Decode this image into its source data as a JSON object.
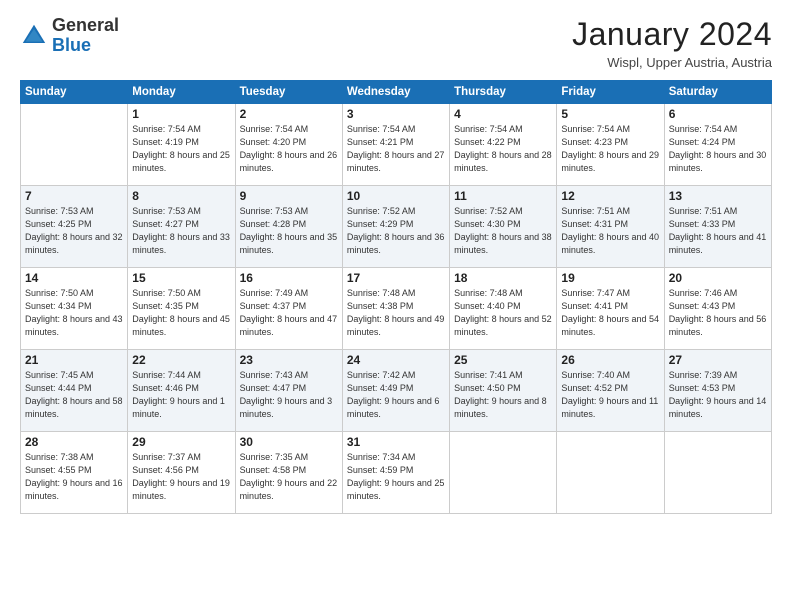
{
  "logo": {
    "text_general": "General",
    "text_blue": "Blue"
  },
  "header": {
    "month_title": "January 2024",
    "location": "Wispl, Upper Austria, Austria"
  },
  "days_of_week": [
    "Sunday",
    "Monday",
    "Tuesday",
    "Wednesday",
    "Thursday",
    "Friday",
    "Saturday"
  ],
  "weeks": [
    {
      "days": [
        {
          "num": "",
          "sunrise": "",
          "sunset": "",
          "daylight": "",
          "empty": true
        },
        {
          "num": "1",
          "sunrise": "Sunrise: 7:54 AM",
          "sunset": "Sunset: 4:19 PM",
          "daylight": "Daylight: 8 hours and 25 minutes.",
          "empty": false
        },
        {
          "num": "2",
          "sunrise": "Sunrise: 7:54 AM",
          "sunset": "Sunset: 4:20 PM",
          "daylight": "Daylight: 8 hours and 26 minutes.",
          "empty": false
        },
        {
          "num": "3",
          "sunrise": "Sunrise: 7:54 AM",
          "sunset": "Sunset: 4:21 PM",
          "daylight": "Daylight: 8 hours and 27 minutes.",
          "empty": false
        },
        {
          "num": "4",
          "sunrise": "Sunrise: 7:54 AM",
          "sunset": "Sunset: 4:22 PM",
          "daylight": "Daylight: 8 hours and 28 minutes.",
          "empty": false
        },
        {
          "num": "5",
          "sunrise": "Sunrise: 7:54 AM",
          "sunset": "Sunset: 4:23 PM",
          "daylight": "Daylight: 8 hours and 29 minutes.",
          "empty": false
        },
        {
          "num": "6",
          "sunrise": "Sunrise: 7:54 AM",
          "sunset": "Sunset: 4:24 PM",
          "daylight": "Daylight: 8 hours and 30 minutes.",
          "empty": false
        }
      ],
      "shaded": false
    },
    {
      "days": [
        {
          "num": "7",
          "sunrise": "Sunrise: 7:53 AM",
          "sunset": "Sunset: 4:25 PM",
          "daylight": "Daylight: 8 hours and 32 minutes.",
          "empty": false
        },
        {
          "num": "8",
          "sunrise": "Sunrise: 7:53 AM",
          "sunset": "Sunset: 4:27 PM",
          "daylight": "Daylight: 8 hours and 33 minutes.",
          "empty": false
        },
        {
          "num": "9",
          "sunrise": "Sunrise: 7:53 AM",
          "sunset": "Sunset: 4:28 PM",
          "daylight": "Daylight: 8 hours and 35 minutes.",
          "empty": false
        },
        {
          "num": "10",
          "sunrise": "Sunrise: 7:52 AM",
          "sunset": "Sunset: 4:29 PM",
          "daylight": "Daylight: 8 hours and 36 minutes.",
          "empty": false
        },
        {
          "num": "11",
          "sunrise": "Sunrise: 7:52 AM",
          "sunset": "Sunset: 4:30 PM",
          "daylight": "Daylight: 8 hours and 38 minutes.",
          "empty": false
        },
        {
          "num": "12",
          "sunrise": "Sunrise: 7:51 AM",
          "sunset": "Sunset: 4:31 PM",
          "daylight": "Daylight: 8 hours and 40 minutes.",
          "empty": false
        },
        {
          "num": "13",
          "sunrise": "Sunrise: 7:51 AM",
          "sunset": "Sunset: 4:33 PM",
          "daylight": "Daylight: 8 hours and 41 minutes.",
          "empty": false
        }
      ],
      "shaded": true
    },
    {
      "days": [
        {
          "num": "14",
          "sunrise": "Sunrise: 7:50 AM",
          "sunset": "Sunset: 4:34 PM",
          "daylight": "Daylight: 8 hours and 43 minutes.",
          "empty": false
        },
        {
          "num": "15",
          "sunrise": "Sunrise: 7:50 AM",
          "sunset": "Sunset: 4:35 PM",
          "daylight": "Daylight: 8 hours and 45 minutes.",
          "empty": false
        },
        {
          "num": "16",
          "sunrise": "Sunrise: 7:49 AM",
          "sunset": "Sunset: 4:37 PM",
          "daylight": "Daylight: 8 hours and 47 minutes.",
          "empty": false
        },
        {
          "num": "17",
          "sunrise": "Sunrise: 7:48 AM",
          "sunset": "Sunset: 4:38 PM",
          "daylight": "Daylight: 8 hours and 49 minutes.",
          "empty": false
        },
        {
          "num": "18",
          "sunrise": "Sunrise: 7:48 AM",
          "sunset": "Sunset: 4:40 PM",
          "daylight": "Daylight: 8 hours and 52 minutes.",
          "empty": false
        },
        {
          "num": "19",
          "sunrise": "Sunrise: 7:47 AM",
          "sunset": "Sunset: 4:41 PM",
          "daylight": "Daylight: 8 hours and 54 minutes.",
          "empty": false
        },
        {
          "num": "20",
          "sunrise": "Sunrise: 7:46 AM",
          "sunset": "Sunset: 4:43 PM",
          "daylight": "Daylight: 8 hours and 56 minutes.",
          "empty": false
        }
      ],
      "shaded": false
    },
    {
      "days": [
        {
          "num": "21",
          "sunrise": "Sunrise: 7:45 AM",
          "sunset": "Sunset: 4:44 PM",
          "daylight": "Daylight: 8 hours and 58 minutes.",
          "empty": false
        },
        {
          "num": "22",
          "sunrise": "Sunrise: 7:44 AM",
          "sunset": "Sunset: 4:46 PM",
          "daylight": "Daylight: 9 hours and 1 minute.",
          "empty": false
        },
        {
          "num": "23",
          "sunrise": "Sunrise: 7:43 AM",
          "sunset": "Sunset: 4:47 PM",
          "daylight": "Daylight: 9 hours and 3 minutes.",
          "empty": false
        },
        {
          "num": "24",
          "sunrise": "Sunrise: 7:42 AM",
          "sunset": "Sunset: 4:49 PM",
          "daylight": "Daylight: 9 hours and 6 minutes.",
          "empty": false
        },
        {
          "num": "25",
          "sunrise": "Sunrise: 7:41 AM",
          "sunset": "Sunset: 4:50 PM",
          "daylight": "Daylight: 9 hours and 8 minutes.",
          "empty": false
        },
        {
          "num": "26",
          "sunrise": "Sunrise: 7:40 AM",
          "sunset": "Sunset: 4:52 PM",
          "daylight": "Daylight: 9 hours and 11 minutes.",
          "empty": false
        },
        {
          "num": "27",
          "sunrise": "Sunrise: 7:39 AM",
          "sunset": "Sunset: 4:53 PM",
          "daylight": "Daylight: 9 hours and 14 minutes.",
          "empty": false
        }
      ],
      "shaded": true
    },
    {
      "days": [
        {
          "num": "28",
          "sunrise": "Sunrise: 7:38 AM",
          "sunset": "Sunset: 4:55 PM",
          "daylight": "Daylight: 9 hours and 16 minutes.",
          "empty": false
        },
        {
          "num": "29",
          "sunrise": "Sunrise: 7:37 AM",
          "sunset": "Sunset: 4:56 PM",
          "daylight": "Daylight: 9 hours and 19 minutes.",
          "empty": false
        },
        {
          "num": "30",
          "sunrise": "Sunrise: 7:35 AM",
          "sunset": "Sunset: 4:58 PM",
          "daylight": "Daylight: 9 hours and 22 minutes.",
          "empty": false
        },
        {
          "num": "31",
          "sunrise": "Sunrise: 7:34 AM",
          "sunset": "Sunset: 4:59 PM",
          "daylight": "Daylight: 9 hours and 25 minutes.",
          "empty": false
        },
        {
          "num": "",
          "sunrise": "",
          "sunset": "",
          "daylight": "",
          "empty": true
        },
        {
          "num": "",
          "sunrise": "",
          "sunset": "",
          "daylight": "",
          "empty": true
        },
        {
          "num": "",
          "sunrise": "",
          "sunset": "",
          "daylight": "",
          "empty": true
        }
      ],
      "shaded": false
    }
  ]
}
